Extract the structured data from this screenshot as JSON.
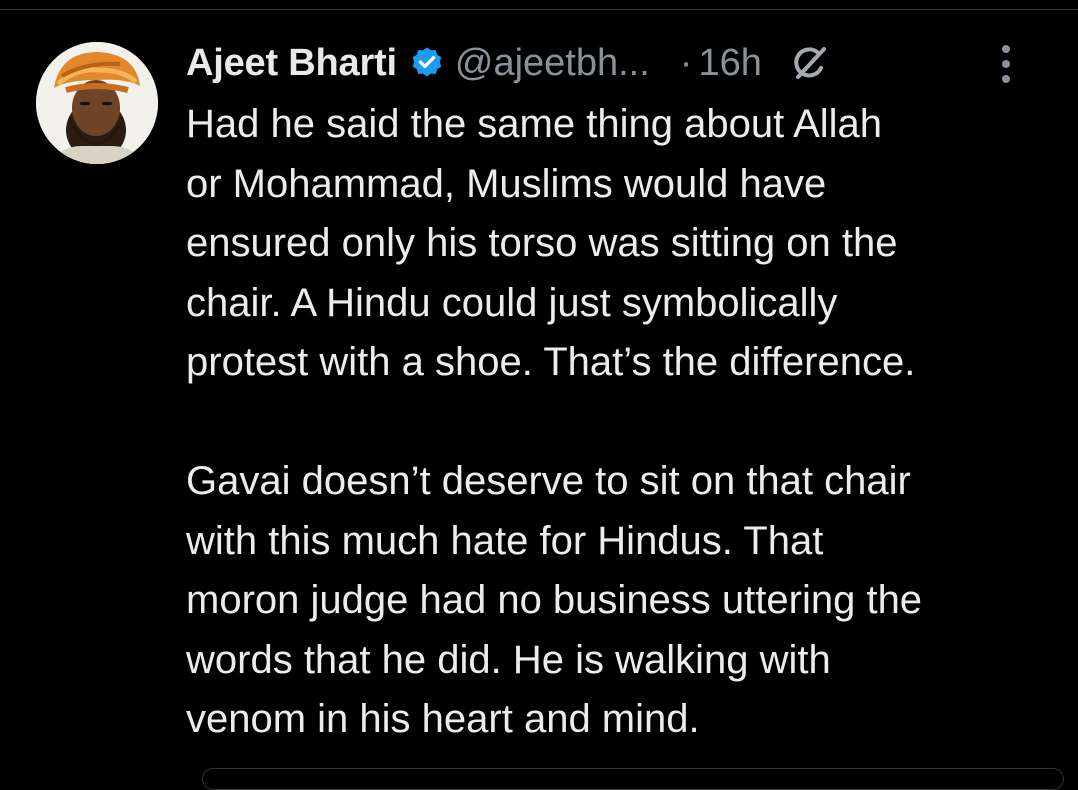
{
  "tweet": {
    "author_name": "Ajeet Bharti",
    "handle": "@ajeetbh...",
    "separator": "·",
    "timestamp": "16h",
    "paragraphs": [
      [
        "Had he said the same thing about Allah",
        "or Mohammad, Muslims would have",
        "ensured only his torso was sitting on the",
        "chair. A Hindu could just symbolically",
        "protest with a shoe. That’s the difference."
      ],
      [
        "Gavai doesn’t deserve to sit on that chair",
        "with this much hate for Hindus. That",
        "moron judge had no business uttering the",
        "words that he did. He is walking with",
        "venom in his heart and mind."
      ]
    ]
  },
  "icons": {
    "verified": "verified-badge-icon",
    "grok": "grok-icon",
    "more": "more-options-icon"
  },
  "colors": {
    "background": "#000000",
    "text": "#e7e9ea",
    "secondary_text": "#8b9198",
    "verified_blue": "#1d9bf0",
    "turban_orange": "#e0882a"
  }
}
